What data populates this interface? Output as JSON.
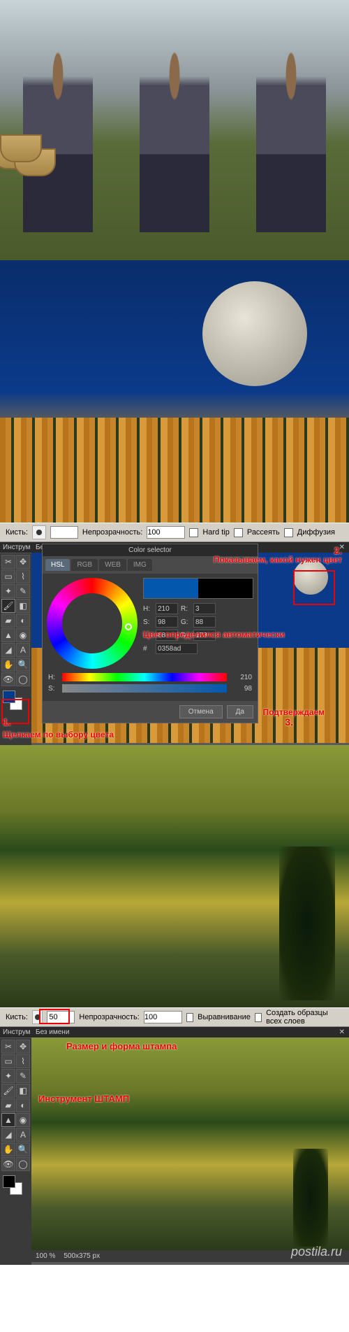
{
  "images": {
    "mushroom_alt": "Three people with baskets picking mushrooms in autumn field",
    "moon_alt": "Large moon over autumn golden forest against blue sky",
    "field_alt": "Golden autumn field with dark pine trees under yellow-green sky"
  },
  "toolbar1": {
    "brush_label": "Кисть:",
    "brush_value": "",
    "opacity_label": "Непрозрачность:",
    "opacity_value": "100",
    "hard_tip": "Hard tip",
    "scatter": "Рассеять",
    "diffusion": "Диффузия"
  },
  "toolbar2": {
    "brush_label": "Кисть:",
    "brush_value": "50",
    "opacity_label": "Непрозрачность:",
    "opacity_value": "100",
    "align": "Выравнивание",
    "sample_all": "Создать образцы всех слоев"
  },
  "panel": {
    "tools_title": "Инструм",
    "doc_title": "Без имени",
    "fg_color": "#003a8a",
    "bg_color": "#ffffff"
  },
  "colorDialog": {
    "title": "Color selector",
    "tabs": {
      "hsl": "HSL",
      "rgb": "RGB",
      "web": "WEB",
      "img": "IMG"
    },
    "H": {
      "label": "H:",
      "value": "210"
    },
    "R": {
      "label": "R:",
      "value": "3"
    },
    "S": {
      "label": "S:",
      "value": "98"
    },
    "G": {
      "label": "G:",
      "value": "88"
    },
    "L": {
      "label": "L:",
      "value": "68"
    },
    "B": {
      "label": "B:",
      "value": "173"
    },
    "hex": {
      "label": "#",
      "value": "0358ad"
    },
    "slider_h": "210",
    "slider_s": "98",
    "cancel": "Отмена",
    "ok": "Да"
  },
  "annotations": {
    "step2": "2.",
    "show_color": "Показываем, какой нужен цвет",
    "auto_color": "Цвет определился автоматически",
    "step1": "1.",
    "click_color": "Щелкаем по выбору цвета",
    "step3": "3.",
    "confirm": "Подтверждаем",
    "stamp_size": "Размер и форма штампа",
    "stamp_tool": "Инструмент ШТАМП"
  },
  "status": {
    "zoom": "100 %",
    "dims": "500x375 px"
  },
  "watermark": "postila.ru",
  "tool_icons": [
    "crop",
    "move",
    "lasso",
    "wand",
    "marquee",
    "pencil",
    "brush",
    "eraser",
    "bucket",
    "gradient",
    "stamp",
    "blur",
    "smudge",
    "sponge",
    "eye",
    "hand",
    "zoom",
    "type",
    "dropper",
    "shape"
  ]
}
